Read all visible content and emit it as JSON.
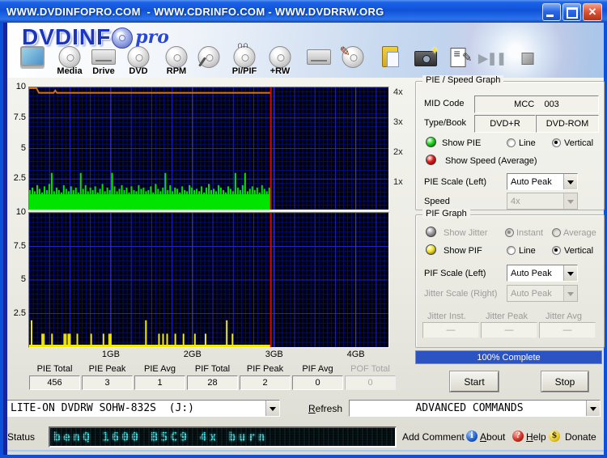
{
  "window": {
    "title": "WWW.DVDINFOPRO.COM  - WWW.CDRINFO.COM - WWW.DVDRRW.ORG"
  },
  "logo": {
    "part1": "DVDINF",
    "part2": "pro"
  },
  "toolbar": {
    "items": [
      {
        "name": "system-info",
        "label": "",
        "kind": "monitor"
      },
      {
        "name": "media-info",
        "label": "Media",
        "kind": "disc"
      },
      {
        "name": "drive-info",
        "label": "Drive",
        "kind": "drive"
      },
      {
        "name": "dvd-info",
        "label": "DVD",
        "kind": "disc"
      },
      {
        "name": "rpm-test",
        "label": "RPM",
        "kind": "disc"
      },
      {
        "name": "read-test",
        "label": "",
        "kind": "disc-magnifier"
      },
      {
        "name": "pi-pif-scan",
        "label": "PI/PIF",
        "kind": "disc-wave"
      },
      {
        "name": "plus-rw-tools",
        "label": "+RW",
        "kind": "disc"
      },
      {
        "name": "drive-tools",
        "label": "",
        "kind": "drive"
      },
      {
        "name": "write-disc",
        "label": "",
        "kind": "disc-pen"
      },
      {
        "name": "copy-clipboard",
        "label": "",
        "kind": "clipboard"
      },
      {
        "name": "screenshot",
        "label": "",
        "kind": "camera"
      },
      {
        "name": "report-notes",
        "label": "",
        "kind": "notes"
      },
      {
        "name": "play-pause",
        "label": "",
        "kind": "playpause"
      },
      {
        "name": "stop-scan",
        "label": "",
        "kind": "stopsq"
      }
    ]
  },
  "chart_data": [
    {
      "type": "bar",
      "name": "pie-speed-graph",
      "x_range_gb": [
        0,
        4.4
      ],
      "x_tick_labels": [
        "1GB",
        "2GB",
        "3GB",
        "4GB"
      ],
      "x_tick_positions_gb": [
        1,
        2,
        3,
        4
      ],
      "y_range": [
        0,
        10
      ],
      "y_tick_labels": [
        "10",
        "7.5",
        "5",
        "2.5"
      ],
      "y_tick_values": [
        10,
        7.5,
        5,
        2.5
      ],
      "right_axis_labels": [
        "4x",
        "3x",
        "2x",
        "1x"
      ],
      "right_axis_values": [
        9.55,
        7.1,
        4.65,
        2.2
      ],
      "bg_color": "#000006",
      "grid_minor_color": "#000d70",
      "grid_major_color": "#2626cc",
      "grid_gb_color": "#4040e8",
      "bar_color": "#00e400",
      "scan_end_gb": 2.96,
      "base_level": 1.25,
      "bar_step_gb": 0.0296,
      "bars": [
        1.6,
        1.8,
        1.5,
        2.0,
        1.7,
        1.4,
        1.9,
        1.6,
        2.1,
        3.0,
        1.5,
        1.8,
        1.6,
        1.4,
        2.0,
        1.7,
        1.5,
        1.9,
        1.6,
        1.8,
        1.4,
        3.0,
        1.7,
        2.0,
        1.5,
        1.8,
        1.6,
        1.9,
        1.4,
        1.7,
        2.1,
        1.5,
        1.8,
        1.6,
        3.0,
        1.9,
        1.5,
        1.7,
        2.0,
        1.6,
        1.8,
        1.4,
        1.9,
        1.6,
        1.5,
        2.0,
        1.7,
        1.8,
        1.5,
        1.6,
        1.9,
        1.4,
        2.1,
        1.7,
        1.5,
        1.8,
        3.0,
        1.6,
        2.0,
        1.5,
        1.8,
        1.7,
        1.4,
        1.9,
        1.6,
        1.5,
        2.0,
        1.8,
        1.6,
        1.7,
        1.5,
        1.9,
        1.4,
        1.8,
        2.1,
        1.6,
        1.7,
        1.5,
        2.0,
        1.8,
        1.6,
        1.4,
        1.9,
        1.7,
        1.5,
        3.0,
        1.8,
        1.6,
        2.0,
        3.0,
        1.5,
        1.7,
        1.9,
        1.6,
        1.8,
        1.4,
        2.0,
        1.7,
        1.5,
        1.8
      ],
      "speed_line": {
        "color": "#d86a10",
        "points_gb_value": [
          [
            0.0,
            9.93
          ],
          [
            0.09,
            9.93
          ],
          [
            0.12,
            9.55
          ],
          [
            0.3,
            9.55
          ],
          [
            0.32,
            9.75
          ],
          [
            0.34,
            9.55
          ],
          [
            2.96,
            9.55
          ]
        ]
      },
      "cursor": {
        "x_gb": 2.96,
        "color": "#e00000"
      }
    },
    {
      "type": "bar",
      "name": "pif-graph",
      "y_range": [
        0,
        10
      ],
      "y_tick_labels": [
        "10",
        "7.5",
        "5",
        "2.5"
      ],
      "y_tick_values": [
        10,
        7.5,
        5,
        2.5
      ],
      "bg_color": "#000006",
      "bar_color": "#f2ea00",
      "baseline_level": 0.18,
      "scan_end_gb": 2.96,
      "spikes_gb_value": [
        [
          0.02,
          2
        ],
        [
          0.15,
          1
        ],
        [
          0.17,
          1
        ],
        [
          0.27,
          1
        ],
        [
          0.42,
          1
        ],
        [
          0.44,
          1
        ],
        [
          0.47,
          1
        ],
        [
          0.49,
          1
        ],
        [
          0.58,
          1
        ],
        [
          0.75,
          1
        ],
        [
          0.9,
          1
        ],
        [
          0.97,
          1
        ],
        [
          0.99,
          1
        ],
        [
          1.42,
          2
        ],
        [
          1.58,
          1
        ],
        [
          1.63,
          1
        ],
        [
          1.68,
          1
        ],
        [
          1.78,
          1
        ],
        [
          1.88,
          1
        ],
        [
          2.02,
          1
        ],
        [
          2.15,
          1
        ],
        [
          2.41,
          2
        ],
        [
          2.48,
          1
        ]
      ],
      "cursor": {
        "x_gb": 2.96,
        "color": "#e00000"
      }
    }
  ],
  "pie_panel": {
    "title": "PIE / Speed Graph",
    "mid_code_label": "MID Code",
    "mid_code_value": "MCC    003",
    "type_book_label": "Type/Book",
    "type_value": "DVD+R",
    "book_value": "DVD-ROM",
    "show_pie": "Show PIE",
    "line": "Line",
    "vertical": "Vertical",
    "show_speed": "Show Speed (Average)",
    "pie_scale_label": "PIE Scale (Left)",
    "pie_scale_value": "Auto Peak",
    "speed_label": "Speed",
    "speed_value": "4x",
    "led_pie_color": "#1ed41e",
    "led_speed_color": "#e01818"
  },
  "pif_panel": {
    "title": "PIF Graph",
    "show_jitter": "Show Jitter",
    "instant": "Instant",
    "average": "Average",
    "show_pif": "Show PIF",
    "line": "Line",
    "vertical": "Vertical",
    "pif_scale_label": "PIF Scale (Left)",
    "pif_scale_value": "Auto Peak",
    "jitter_scale_label": "Jitter Scale (Right)",
    "jitter_scale_value": "Auto Peak",
    "jitter_inst_label": "Jitter Inst.",
    "jitter_peak_label": "Jitter Peak",
    "jitter_avg_label": "Jitter Avg",
    "jitter_inst_value": "—",
    "jitter_peak_value": "—",
    "jitter_avg_value": "—",
    "led_pif_color": "#f0e020",
    "led_jitter_color": "#a0a0a0"
  },
  "progress": {
    "text": "100% Complete",
    "percent": 100,
    "bar_color": "#2b53c2"
  },
  "actions": {
    "start": "Start",
    "stop": "Stop"
  },
  "stats": {
    "columns": [
      {
        "label": "PIE Total",
        "value": "456",
        "disabled": false
      },
      {
        "label": "PIE Peak",
        "value": "3",
        "disabled": false
      },
      {
        "label": "PIE Avg",
        "value": "1",
        "disabled": false
      },
      {
        "label": "PIF Total",
        "value": "28",
        "disabled": false
      },
      {
        "label": "PIF Peak",
        "value": "2",
        "disabled": false
      },
      {
        "label": "PIF Avg",
        "value": "0",
        "disabled": false
      },
      {
        "label": "POF Total",
        "value": "0",
        "disabled": true
      }
    ]
  },
  "drive_bar": {
    "drive_value": "LITE-ON DVDRW SOHW-832S  (J:)",
    "refresh_accel": "R",
    "refresh_rest": "efresh",
    "advanced_value": "ADVANCED COMMANDS"
  },
  "status_bar": {
    "label": "Status",
    "lcd_text": "benQ 1600 B5C9 4x burn",
    "add_comment": "Add Comment",
    "about_accel": "A",
    "about_rest": "bout",
    "help_accel": "H",
    "help_rest": "elp",
    "donate": "Donate"
  }
}
